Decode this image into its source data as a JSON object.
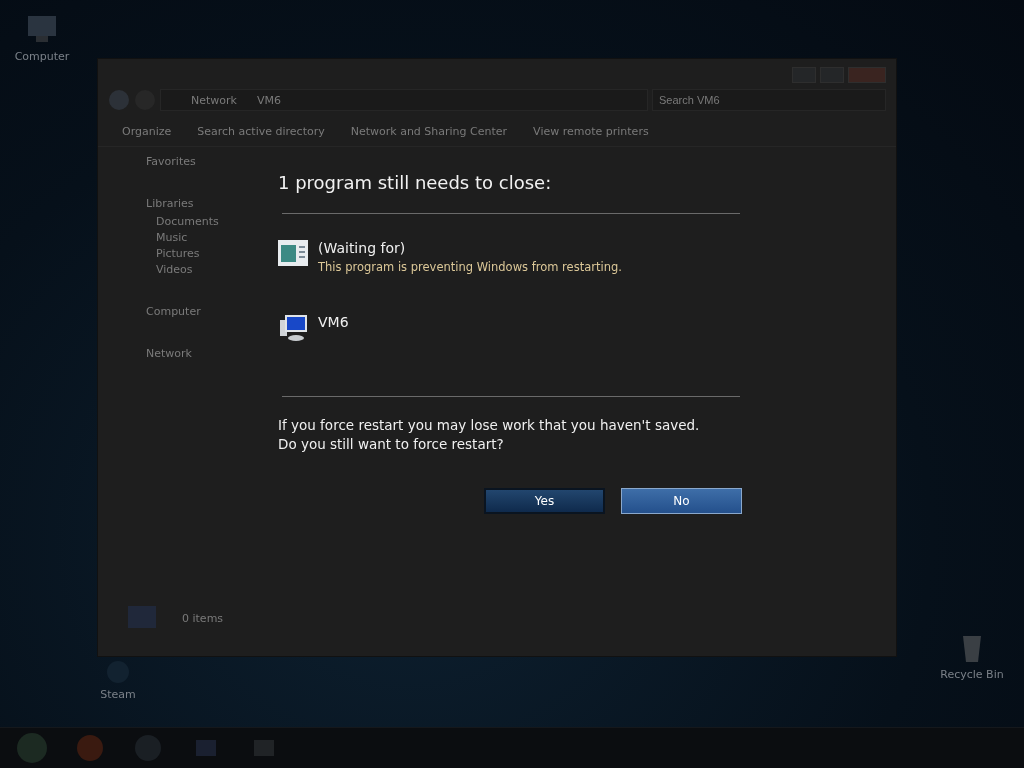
{
  "desktop": {
    "icons": [
      {
        "label": "Computer",
        "kind": "computer"
      },
      {
        "label": "Steam",
        "kind": "steam"
      },
      {
        "label": "Recycle Bin",
        "kind": "bin"
      }
    ]
  },
  "explorer": {
    "breadcrumb": [
      "Network",
      "VM6"
    ],
    "search": {
      "placeholder": "Search VM6"
    },
    "toolbar": [
      "Organize",
      "Search active directory",
      "Network and Sharing Center",
      "View remote printers"
    ],
    "nav": [
      {
        "label": "Favorites"
      },
      {
        "label": "Libraries",
        "children": [
          {
            "label": "Documents"
          },
          {
            "label": "Music"
          },
          {
            "label": "Pictures"
          },
          {
            "label": "Videos"
          }
        ]
      },
      {
        "label": "Computer"
      },
      {
        "label": "Network"
      }
    ],
    "status": "0 items"
  },
  "dialog": {
    "title": "1 program still needs to close:",
    "programs": [
      {
        "kind": "app",
        "name": "(Waiting for)",
        "note": "This program is preventing Windows from restarting."
      },
      {
        "kind": "computer",
        "name": "VM6"
      }
    ],
    "message": [
      "If you force restart you may lose work that you haven't saved.",
      "Do you still want to force restart?"
    ],
    "buttons": [
      {
        "label": "Yes",
        "selected": true
      },
      {
        "label": "No",
        "selected": false
      }
    ]
  }
}
